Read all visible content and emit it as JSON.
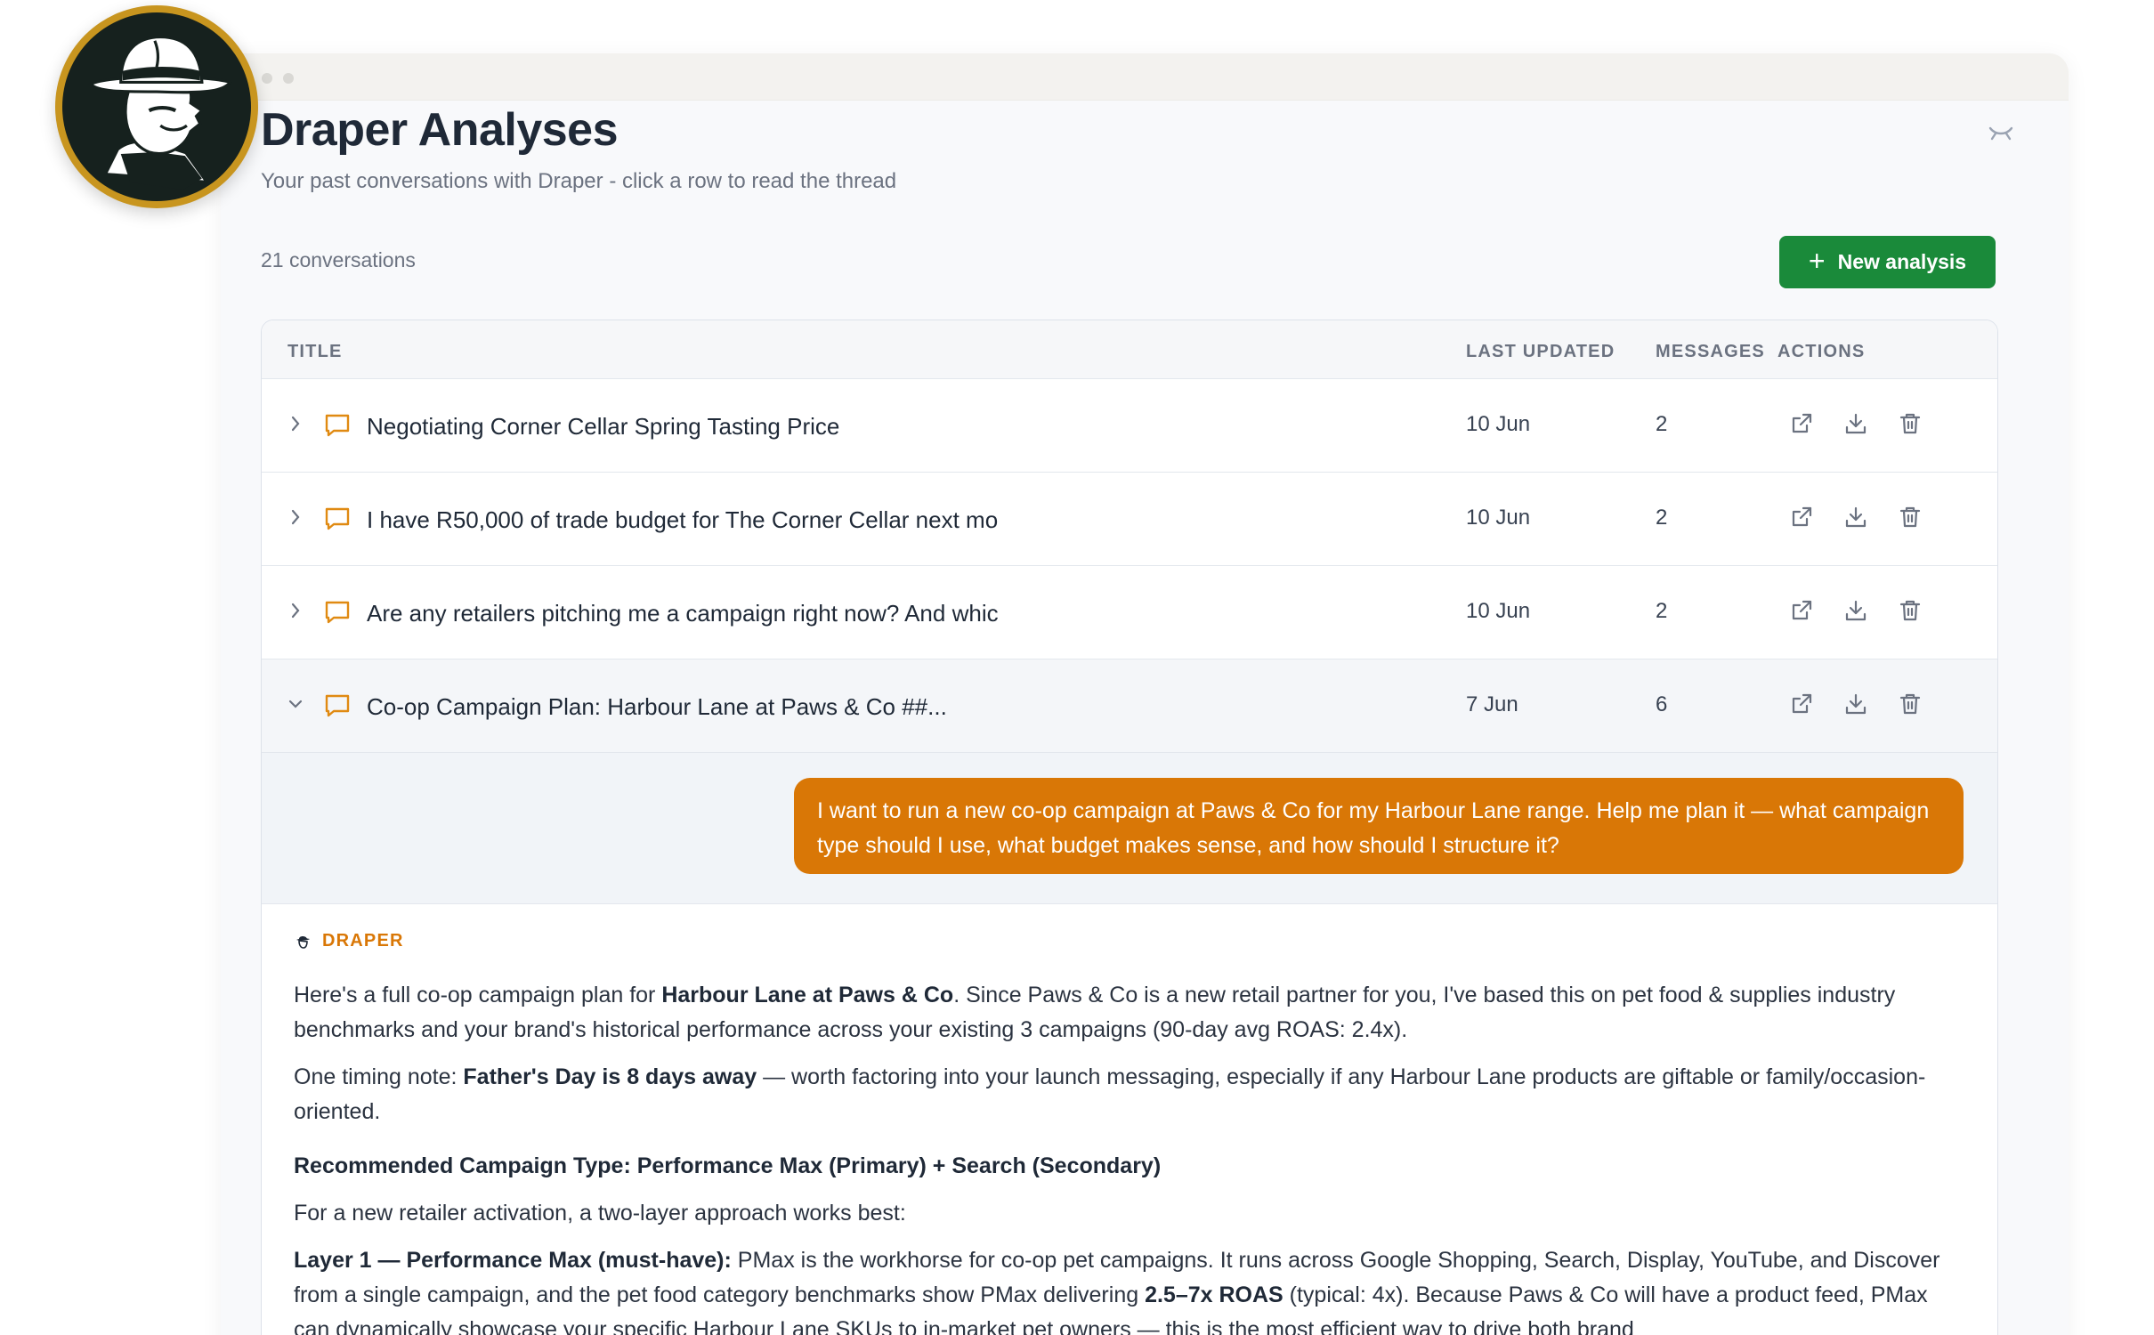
{
  "page": {
    "title": "Draper Analyses",
    "subtitle": "Your past conversations with Draper - click a row to read the thread",
    "count": "21 conversations",
    "new_button": "New analysis"
  },
  "table": {
    "headers": {
      "title": "TITLE",
      "updated": "LAST UPDATED",
      "messages": "MESSAGES",
      "actions": "ACTIONS"
    },
    "rows": [
      {
        "title": "Negotiating Corner Cellar Spring Tasting Price",
        "updated": "10 Jun",
        "messages": "2"
      },
      {
        "title": "I have R50,000 of trade budget for The Corner Cellar next mo",
        "updated": "10 Jun",
        "messages": "2"
      },
      {
        "title": "Are any retailers pitching me a campaign right now? And whic",
        "updated": "10 Jun",
        "messages": "2"
      },
      {
        "title": "Co-op Campaign Plan: Harbour Lane at Paws & Co ##...",
        "updated": "7 Jun",
        "messages": "6"
      }
    ]
  },
  "thread": {
    "user_message": "I want to run a new co-op campaign at Paws & Co for my Harbour Lane range. Help me plan it — what campaign type should I use, what budget makes sense, and how should I structure it?",
    "assistant_label": "DRAPER",
    "p1": {
      "a": "Here's a full co-op campaign plan for ",
      "b": "Harbour Lane at Paws & Co",
      "c": ". Since Paws & Co is a new retail partner for you, I've based this on pet food & supplies industry benchmarks and your brand's historical performance across your existing 3 campaigns (90-day avg ROAS: 2.4x)."
    },
    "p2": {
      "a": "One timing note: ",
      "b": "Father's Day is 8 days away",
      "c": " — worth factoring into your launch messaging, especially if any Harbour Lane products are giftable or family/occasion-oriented."
    },
    "heading": "Recommended Campaign Type: Performance Max (Primary) + Search (Secondary)",
    "p3": "For a new retailer activation, a two-layer approach works best:",
    "p4": {
      "a": "Layer 1 — Performance Max (must-have):",
      "b": " PMax is the workhorse for co-op pet campaigns. It runs across Google Shopping, Search, Display, YouTube, and Discover from a single campaign, and the pet food category benchmarks show PMax delivering ",
      "c": "2.5–7x ROAS",
      "d": " (typical: 4x). Because Paws & Co will have a product feed, PMax can dynamically showcase your specific Harbour Lane SKUs to in-market pet owners — this is the most efficient way to drive both brand"
    }
  },
  "colors": {
    "accent": "#d97706",
    "button": "#1a8a3a",
    "avatar_ring": "#c8951f"
  }
}
